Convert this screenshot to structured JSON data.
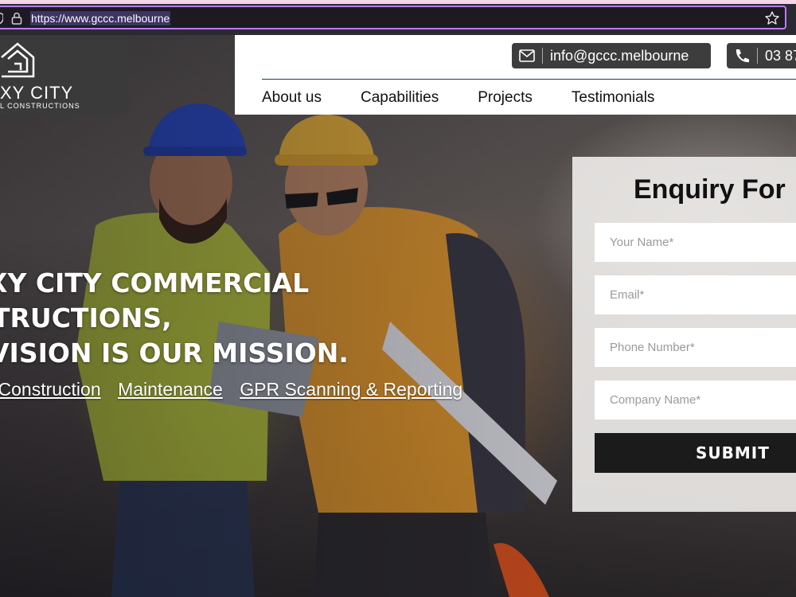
{
  "browser": {
    "url": "https://www.gccc.melbourne",
    "icons": [
      "shield-icon",
      "lock-icon",
      "star-icon"
    ]
  },
  "logo": {
    "title": "XY CITY",
    "subtitle": "L CONSTRUCTIONS"
  },
  "header": {
    "email": "info@gccc.melbourne",
    "phone": "03 87",
    "icons": [
      "mail-icon",
      "phone-icon"
    ],
    "nav": [
      "About us",
      "Capabilities",
      "Projects",
      "Testimonials"
    ]
  },
  "hero": {
    "title_lines": [
      "XY CITY COMMERCIAL",
      "TRUCTIONS,",
      "VISION IS OUR MISSION."
    ],
    "links": [
      "l Construction",
      "Maintenance",
      "GPR Scanning & Reporting"
    ]
  },
  "form": {
    "title": "Enquiry For",
    "fields": [
      {
        "placeholder": "Your Name*"
      },
      {
        "placeholder": "Email*"
      },
      {
        "placeholder": "Phone Number*"
      },
      {
        "placeholder": "Company Name*"
      }
    ],
    "submit_label": "SUBMIT"
  },
  "colors": {
    "accent_border": "#b87cf0",
    "contact_box": "#3d3d3d",
    "submit": "#1b1b1b"
  }
}
